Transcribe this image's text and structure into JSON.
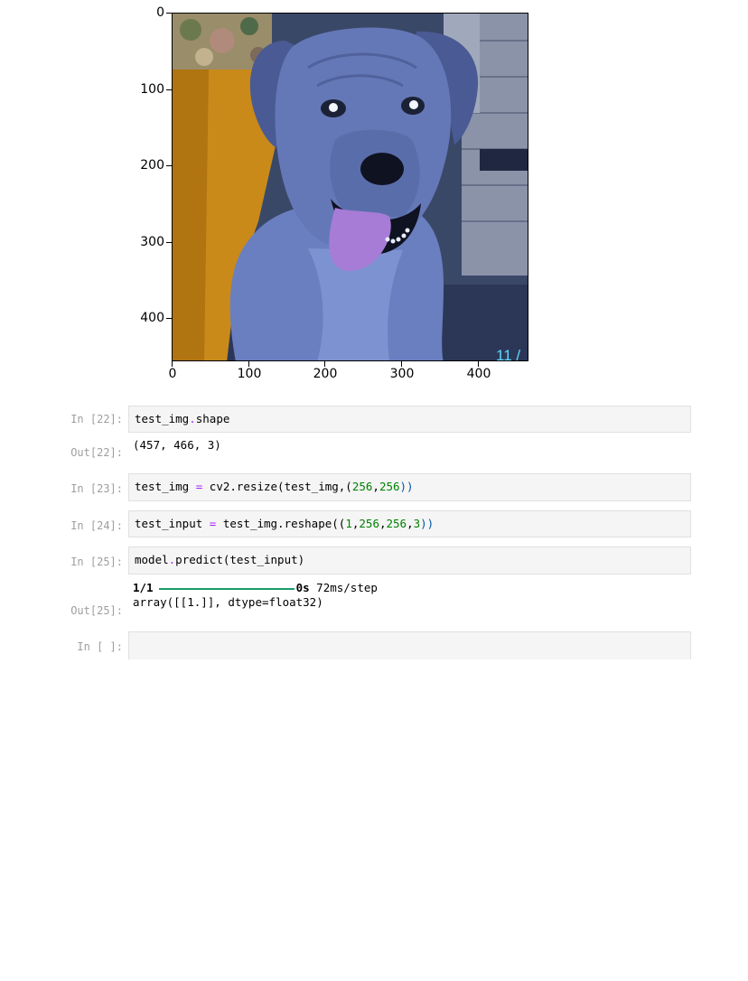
{
  "figure": {
    "y_ticks": [
      "0",
      "100",
      "200",
      "300",
      "400"
    ],
    "x_ticks": [
      "0",
      "100",
      "200",
      "300",
      "400"
    ],
    "photo_corner_text": "11 /"
  },
  "cells": [
    {
      "prompt": "In [22]:",
      "code": {
        "a": "test_img",
        "b": ".",
        "c": "shape"
      },
      "out_prompt": "Out[22]:",
      "output": "(457, 466, 3)"
    },
    {
      "prompt": "In [23]:",
      "code": {
        "a": "test_img ",
        "op": "=",
        "b": " cv2.resize(test_img,(",
        "n1": "256",
        "c": ",",
        "n2": "256",
        "d": "))"
      }
    },
    {
      "prompt": "In [24]:",
      "code": {
        "a": "test_input ",
        "op": "=",
        "b": " test_img.reshape((",
        "n1": "1",
        "c1": ",",
        "n2": "256",
        "c2": ",",
        "n3": "256",
        "c3": ",",
        "n4": "3",
        "d": "))"
      }
    },
    {
      "prompt": "In [25]:",
      "code": {
        "a": "model",
        "b": ".",
        "c": "predict(test_input)"
      },
      "out_prompt": "Out[25]:",
      "progress": {
        "step": "1/1",
        "time": "0s",
        "rate": "72ms/step",
        "fraction": 1.0
      },
      "output": "array([[1.]], dtype=float32)"
    },
    {
      "prompt": "In [ ]:",
      "code": ""
    }
  ]
}
